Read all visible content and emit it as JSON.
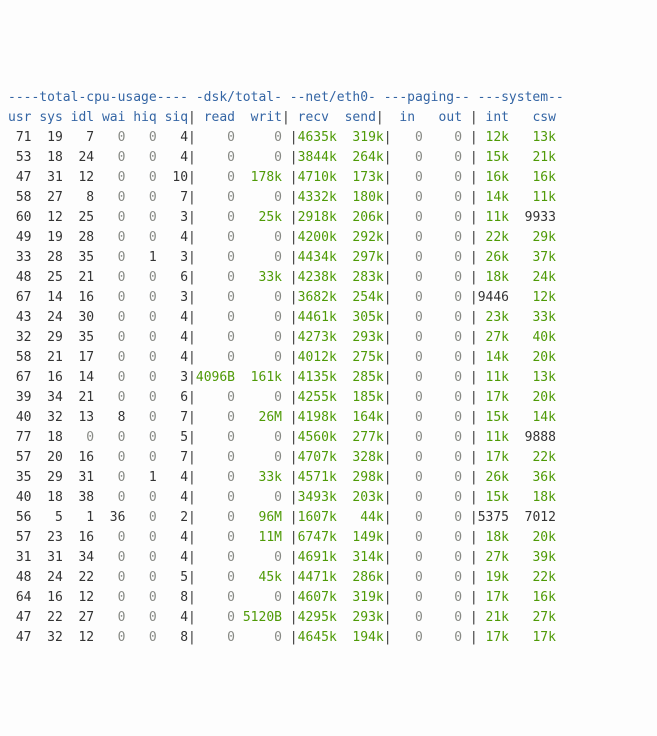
{
  "headers": {
    "groups": [
      {
        "text": "----total-cpu-usage----",
        "cls": "hdr"
      },
      {
        "text": " ",
        "cls": "sep"
      },
      {
        "text": "-dsk/total-",
        "cls": "hdr"
      },
      {
        "text": " ",
        "cls": "sep"
      },
      {
        "text": "--net/eth0-",
        "cls": "hdr"
      },
      {
        "text": " ",
        "cls": "sep"
      },
      {
        "text": "---paging--",
        "cls": "hdr"
      },
      {
        "text": " ",
        "cls": "sep"
      },
      {
        "text": "---system--",
        "cls": "hdr"
      }
    ],
    "cols": [
      {
        "text": "usr",
        "cls": "hdr"
      },
      {
        "text": " ",
        "cls": "sep"
      },
      {
        "text": "sys",
        "cls": "hdr"
      },
      {
        "text": " ",
        "cls": "sep"
      },
      {
        "text": "idl",
        "cls": "hdr"
      },
      {
        "text": " ",
        "cls": "sep"
      },
      {
        "text": "wai",
        "cls": "hdr"
      },
      {
        "text": " ",
        "cls": "sep"
      },
      {
        "text": "hiq",
        "cls": "hdr"
      },
      {
        "text": " ",
        "cls": "sep"
      },
      {
        "text": "siq",
        "cls": "hdr"
      },
      {
        "text": "|",
        "cls": "pipe"
      },
      {
        "text": " read",
        "cls": "hdr"
      },
      {
        "text": "  ",
        "cls": "sep"
      },
      {
        "text": "writ",
        "cls": "hdr"
      },
      {
        "text": "|",
        "cls": "pipe"
      },
      {
        "text": " recv",
        "cls": "hdr"
      },
      {
        "text": "  ",
        "cls": "sep"
      },
      {
        "text": "send",
        "cls": "hdr"
      },
      {
        "text": "|",
        "cls": "pipe"
      },
      {
        "text": "  in",
        "cls": "hdr"
      },
      {
        "text": "   ",
        "cls": "sep"
      },
      {
        "text": "out",
        "cls": "hdr"
      },
      {
        "text": " |",
        "cls": "pipe"
      },
      {
        "text": " int",
        "cls": "hdr"
      },
      {
        "text": "   ",
        "cls": "sep"
      },
      {
        "text": "csw",
        "cls": "hdr"
      },
      {
        "text": " ",
        "cls": "sep"
      }
    ]
  },
  "rows": [
    {
      "usr": "71",
      "sys": "19",
      "idl": "7",
      "wai": "0",
      "hiq": "0",
      "siq": "4",
      "read": "0",
      "writ": "0",
      "recv": "4635k",
      "send": "319k",
      "in": "0",
      "out": "0",
      "int": "12k",
      "csw": "13k"
    },
    {
      "usr": "53",
      "sys": "18",
      "idl": "24",
      "wai": "0",
      "hiq": "0",
      "siq": "4",
      "read": "0",
      "writ": "0",
      "recv": "3844k",
      "send": "264k",
      "in": "0",
      "out": "0",
      "int": "15k",
      "csw": "21k"
    },
    {
      "usr": "47",
      "sys": "31",
      "idl": "12",
      "wai": "0",
      "hiq": "0",
      "siq": "10",
      "read": "0",
      "writ": "178k",
      "recv": "4710k",
      "send": "173k",
      "in": "0",
      "out": "0",
      "int": "16k",
      "csw": "16k"
    },
    {
      "usr": "58",
      "sys": "27",
      "idl": "8",
      "wai": "0",
      "hiq": "0",
      "siq": "7",
      "read": "0",
      "writ": "0",
      "recv": "4332k",
      "send": "180k",
      "in": "0",
      "out": "0",
      "int": "14k",
      "csw": "11k"
    },
    {
      "usr": "60",
      "sys": "12",
      "idl": "25",
      "wai": "0",
      "hiq": "0",
      "siq": "3",
      "read": "0",
      "writ": "25k",
      "recv": "2918k",
      "send": "206k",
      "in": "0",
      "out": "0",
      "int": "11k",
      "csw": "9933"
    },
    {
      "usr": "49",
      "sys": "19",
      "idl": "28",
      "wai": "0",
      "hiq": "0",
      "siq": "4",
      "read": "0",
      "writ": "0",
      "recv": "4200k",
      "send": "292k",
      "in": "0",
      "out": "0",
      "int": "22k",
      "csw": "29k"
    },
    {
      "usr": "33",
      "sys": "28",
      "idl": "35",
      "wai": "0",
      "hiq": "1",
      "siq": "3",
      "read": "0",
      "writ": "0",
      "recv": "4434k",
      "send": "297k",
      "in": "0",
      "out": "0",
      "int": "26k",
      "csw": "37k"
    },
    {
      "usr": "48",
      "sys": "25",
      "idl": "21",
      "wai": "0",
      "hiq": "0",
      "siq": "6",
      "read": "0",
      "writ": "33k",
      "recv": "4238k",
      "send": "283k",
      "in": "0",
      "out": "0",
      "int": "18k",
      "csw": "24k"
    },
    {
      "usr": "67",
      "sys": "14",
      "idl": "16",
      "wai": "0",
      "hiq": "0",
      "siq": "3",
      "read": "0",
      "writ": "0",
      "recv": "3682k",
      "send": "254k",
      "in": "0",
      "out": "0",
      "int": "9446",
      "csw": "12k"
    },
    {
      "usr": "43",
      "sys": "24",
      "idl": "30",
      "wai": "0",
      "hiq": "0",
      "siq": "4",
      "read": "0",
      "writ": "0",
      "recv": "4461k",
      "send": "305k",
      "in": "0",
      "out": "0",
      "int": "23k",
      "csw": "33k"
    },
    {
      "usr": "32",
      "sys": "29",
      "idl": "35",
      "wai": "0",
      "hiq": "0",
      "siq": "4",
      "read": "0",
      "writ": "0",
      "recv": "4273k",
      "send": "293k",
      "in": "0",
      "out": "0",
      "int": "27k",
      "csw": "40k"
    },
    {
      "usr": "58",
      "sys": "21",
      "idl": "17",
      "wai": "0",
      "hiq": "0",
      "siq": "4",
      "read": "0",
      "writ": "0",
      "recv": "4012k",
      "send": "275k",
      "in": "0",
      "out": "0",
      "int": "14k",
      "csw": "20k"
    },
    {
      "usr": "67",
      "sys": "16",
      "idl": "14",
      "wai": "0",
      "hiq": "0",
      "siq": "3",
      "read": "4096B",
      "writ": "161k",
      "recv": "4135k",
      "send": "285k",
      "in": "0",
      "out": "0",
      "int": "11k",
      "csw": "13k"
    },
    {
      "usr": "39",
      "sys": "34",
      "idl": "21",
      "wai": "0",
      "hiq": "0",
      "siq": "6",
      "read": "0",
      "writ": "0",
      "recv": "4255k",
      "send": "185k",
      "in": "0",
      "out": "0",
      "int": "17k",
      "csw": "20k"
    },
    {
      "usr": "40",
      "sys": "32",
      "idl": "13",
      "wai": "8",
      "hiq": "0",
      "siq": "7",
      "read": "0",
      "writ": "26M",
      "recv": "4198k",
      "send": "164k",
      "in": "0",
      "out": "0",
      "int": "15k",
      "csw": "14k"
    },
    {
      "usr": "77",
      "sys": "18",
      "idl": "0",
      "wai": "0",
      "hiq": "0",
      "siq": "5",
      "read": "0",
      "writ": "0",
      "recv": "4560k",
      "send": "277k",
      "in": "0",
      "out": "0",
      "int": "11k",
      "csw": "9888"
    },
    {
      "usr": "57",
      "sys": "20",
      "idl": "16",
      "wai": "0",
      "hiq": "0",
      "siq": "7",
      "read": "0",
      "writ": "0",
      "recv": "4707k",
      "send": "328k",
      "in": "0",
      "out": "0",
      "int": "17k",
      "csw": "22k"
    },
    {
      "usr": "35",
      "sys": "29",
      "idl": "31",
      "wai": "0",
      "hiq": "1",
      "siq": "4",
      "read": "0",
      "writ": "33k",
      "recv": "4571k",
      "send": "298k",
      "in": "0",
      "out": "0",
      "int": "26k",
      "csw": "36k"
    },
    {
      "usr": "40",
      "sys": "18",
      "idl": "38",
      "wai": "0",
      "hiq": "0",
      "siq": "4",
      "read": "0",
      "writ": "0",
      "recv": "3493k",
      "send": "203k",
      "in": "0",
      "out": "0",
      "int": "15k",
      "csw": "18k"
    },
    {
      "usr": "56",
      "sys": "5",
      "idl": "1",
      "wai": "36",
      "hiq": "0",
      "siq": "2",
      "read": "0",
      "writ": "96M",
      "recv": "1607k",
      "send": "44k",
      "in": "0",
      "out": "0",
      "int": "5375",
      "csw": "7012"
    },
    {
      "usr": "57",
      "sys": "23",
      "idl": "16",
      "wai": "0",
      "hiq": "0",
      "siq": "4",
      "read": "0",
      "writ": "11M",
      "recv": "6747k",
      "send": "149k",
      "in": "0",
      "out": "0",
      "int": "18k",
      "csw": "20k"
    },
    {
      "usr": "31",
      "sys": "31",
      "idl": "34",
      "wai": "0",
      "hiq": "0",
      "siq": "4",
      "read": "0",
      "writ": "0",
      "recv": "4691k",
      "send": "314k",
      "in": "0",
      "out": "0",
      "int": "27k",
      "csw": "39k"
    },
    {
      "usr": "48",
      "sys": "24",
      "idl": "22",
      "wai": "0",
      "hiq": "0",
      "siq": "5",
      "read": "0",
      "writ": "45k",
      "recv": "4471k",
      "send": "286k",
      "in": "0",
      "out": "0",
      "int": "19k",
      "csw": "22k"
    },
    {
      "usr": "64",
      "sys": "16",
      "idl": "12",
      "wai": "0",
      "hiq": "0",
      "siq": "8",
      "read": "0",
      "writ": "0",
      "recv": "4607k",
      "send": "319k",
      "in": "0",
      "out": "0",
      "int": "17k",
      "csw": "16k"
    },
    {
      "usr": "47",
      "sys": "22",
      "idl": "27",
      "wai": "0",
      "hiq": "0",
      "siq": "4",
      "read": "0",
      "writ": "5120B",
      "recv": "4295k",
      "send": "293k",
      "in": "0",
      "out": "0",
      "int": "21k",
      "csw": "27k"
    },
    {
      "usr": "47",
      "sys": "32",
      "idl": "12",
      "wai": "0",
      "hiq": "0",
      "siq": "8",
      "read": "0",
      "writ": "0",
      "recv": "4645k",
      "send": "194k",
      "in": "0",
      "out": "0",
      "int": "17k",
      "csw": "17k"
    }
  ],
  "widths": {
    "usr": 3,
    "sys": 4,
    "idl": 4,
    "wai": 4,
    "hiq": 4,
    "siq": 4,
    "read": 5,
    "writ": 6,
    "recv": 5,
    "send": 6,
    "in": 4,
    "out": 5,
    "int": 4,
    "csw": 6
  }
}
